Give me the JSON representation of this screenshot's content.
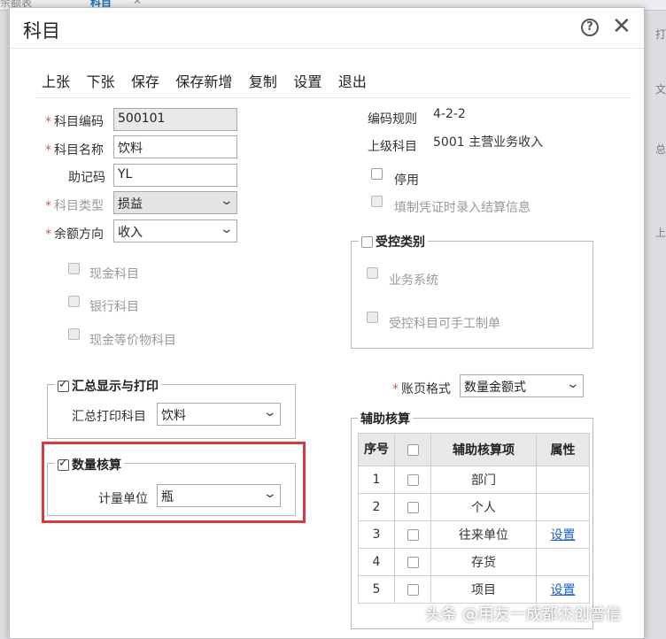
{
  "background": {
    "tab_left": "余额表",
    "tab_active": "科目",
    "tab_close": "✕",
    "right_edge_chars": [
      "打",
      "文",
      "总",
      "上"
    ]
  },
  "dialog": {
    "title": "科目",
    "toolbar": [
      "上张",
      "下张",
      "保存",
      "保存新增",
      "复制",
      "设置",
      "退出"
    ],
    "form": {
      "code_label": "科目编码",
      "code_value": "500101",
      "name_label": "科目名称",
      "name_value": "饮料",
      "mnemonic_label": "助记码",
      "mnemonic_value": "YL",
      "type_label": "科目类型",
      "type_value": "损益",
      "direction_label": "余额方向",
      "direction_value": "收入",
      "cash_label": "现金科目",
      "bank_label": "银行科目",
      "cash_equiv_label": "现金等价物科目"
    },
    "right": {
      "rule_label": "编码规则",
      "rule_value": "4-2-2",
      "parent_label": "上级科目",
      "parent_value": "5001 主营业务收入",
      "disabled_label": "停用",
      "settle_label": "填制凭证时录入结算信息"
    },
    "controlled": {
      "legend": "受控类别",
      "biz_label": "业务系统",
      "manual_label": "受控科目可手工制单"
    },
    "summary": {
      "legend": "汇总显示与打印",
      "print_label": "汇总打印科目",
      "print_value": "饮料"
    },
    "quantity": {
      "legend": "数量核算",
      "unit_label": "计量单位",
      "unit_value": "瓶"
    },
    "ledger": {
      "label": "账页格式",
      "value": "数量金额式"
    },
    "aux": {
      "legend": "辅助核算",
      "headers": [
        "序号",
        "辅助核算项",
        "属性"
      ],
      "rows": [
        {
          "no": "1",
          "item": "部门",
          "attr": ""
        },
        {
          "no": "2",
          "item": "个人",
          "attr": ""
        },
        {
          "no": "3",
          "item": "往来单位",
          "attr": "设置"
        },
        {
          "no": "4",
          "item": "存货",
          "attr": ""
        },
        {
          "no": "5",
          "item": "项目",
          "attr": "设置"
        }
      ]
    }
  },
  "watermark": "头条 @用友一成都杰创普信"
}
